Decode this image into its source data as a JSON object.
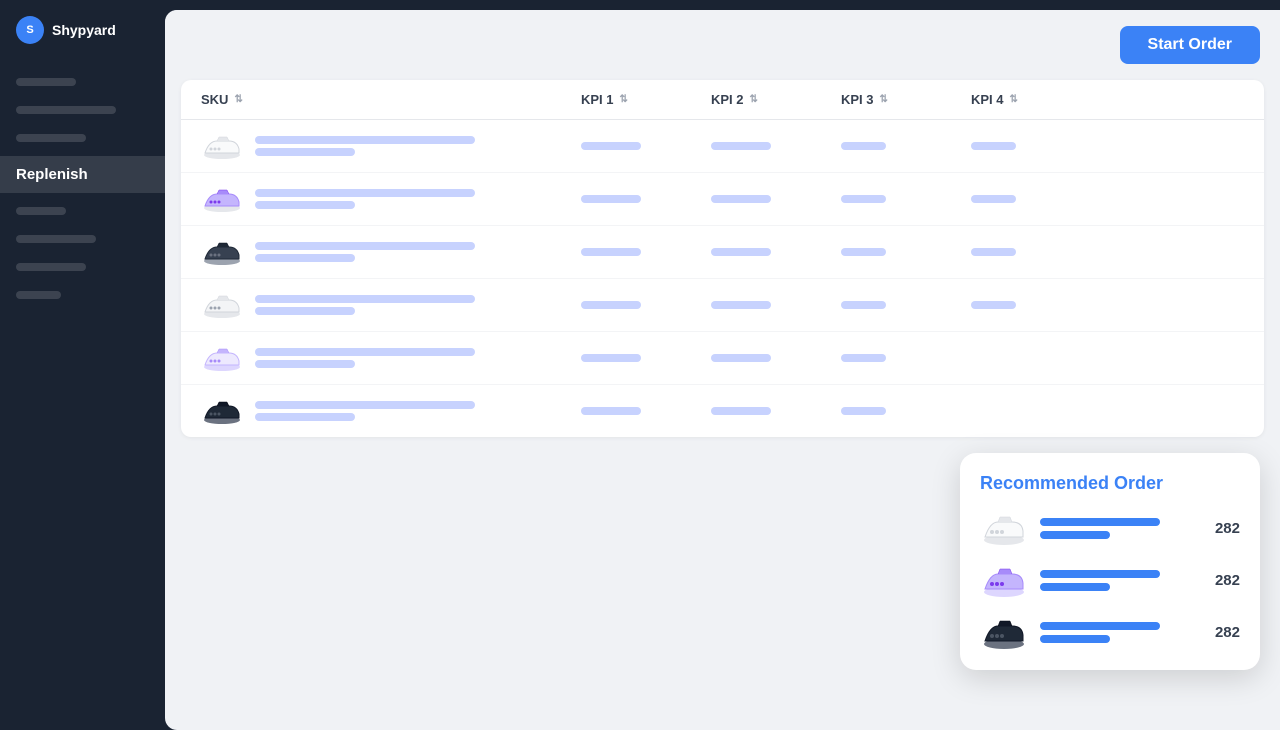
{
  "app": {
    "name": "Shypyard",
    "logo_letter": "S"
  },
  "sidebar": {
    "active_item": "Replenish",
    "skeleton_items": [
      {
        "width": 60
      },
      {
        "width": 100
      },
      {
        "width": 70
      },
      {
        "width": 50
      },
      {
        "width": 80
      },
      {
        "width": 45
      }
    ]
  },
  "header": {
    "start_order_label": "Start Order"
  },
  "table": {
    "columns": [
      {
        "label": "SKU",
        "key": "sku"
      },
      {
        "label": "KPI 1",
        "key": "kpi1"
      },
      {
        "label": "KPI 2",
        "key": "kpi2"
      },
      {
        "label": "KPI 3",
        "key": "kpi3"
      },
      {
        "label": "KPI 4",
        "key": "kpi4"
      }
    ],
    "rows": [
      {
        "shoe_color": "white",
        "id": 1
      },
      {
        "shoe_color": "purple",
        "id": 2
      },
      {
        "shoe_color": "black",
        "id": 3
      },
      {
        "shoe_color": "white2",
        "id": 4
      },
      {
        "shoe_color": "purple2",
        "id": 5
      },
      {
        "shoe_color": "black2",
        "id": 6
      }
    ]
  },
  "recommended_order": {
    "title": "Recommended Order",
    "items": [
      {
        "shoe_color": "white",
        "count": 282
      },
      {
        "shoe_color": "purple",
        "count": 282
      },
      {
        "shoe_color": "black",
        "count": 282
      }
    ]
  }
}
